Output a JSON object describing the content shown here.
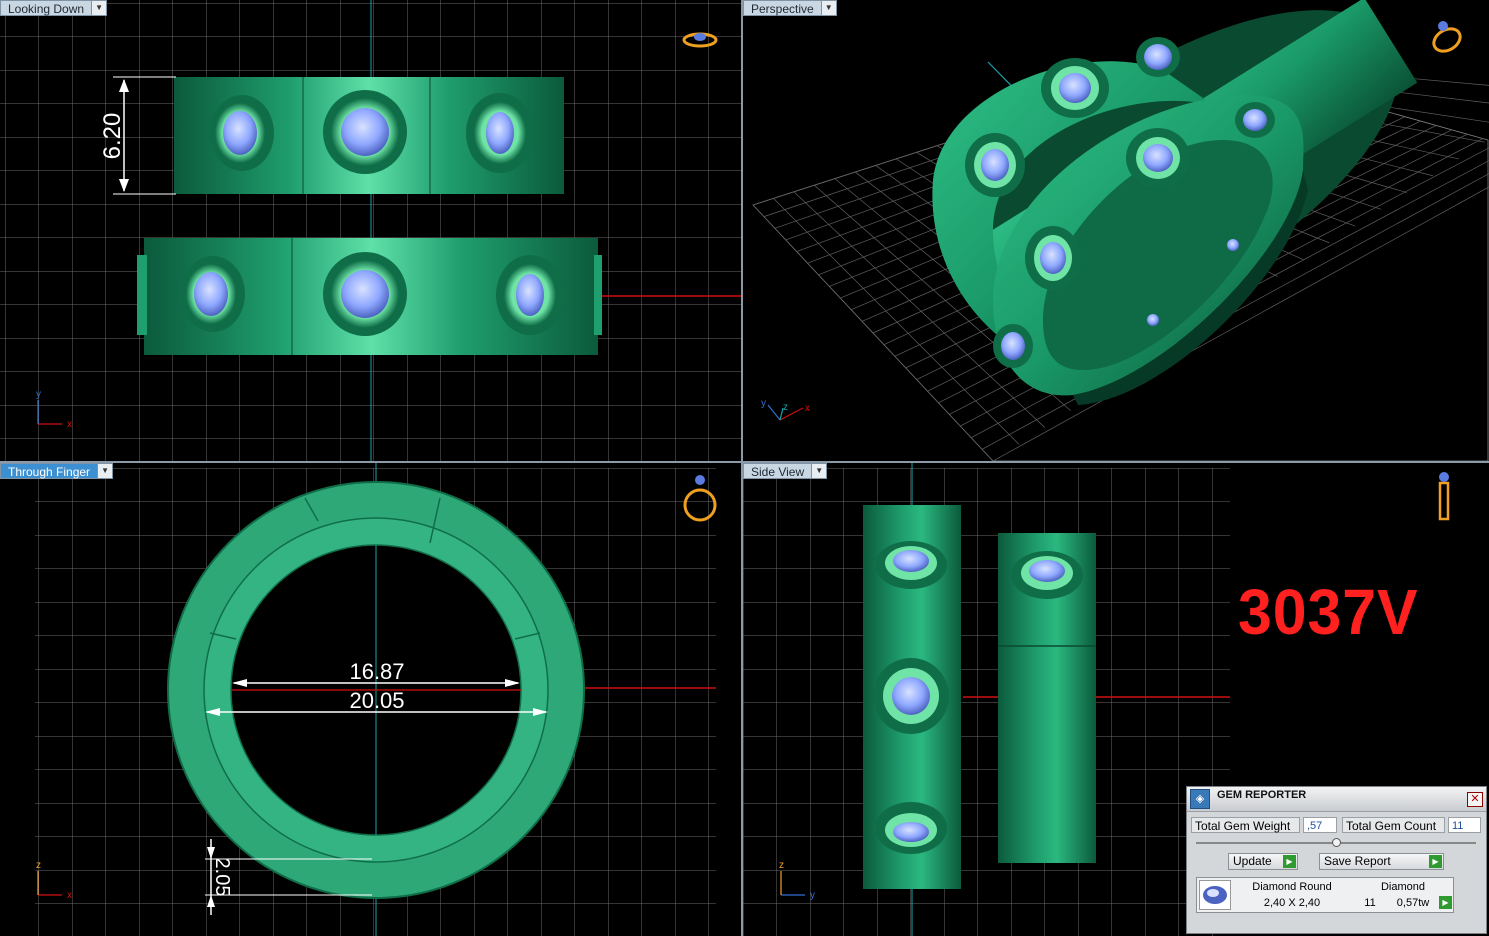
{
  "viewports": {
    "top_left": {
      "label": "Looking Down",
      "dimension": "6.20"
    },
    "top_right": {
      "label": "Perspective"
    },
    "bottom_left": {
      "label": "Through Finger",
      "dim_inner": "16.87",
      "dim_outer": "20.05",
      "dim_thickness": "2.05"
    },
    "bottom_right": {
      "label": "Side View"
    }
  },
  "axes": {
    "x": "x",
    "y": "y",
    "z": "z"
  },
  "product_code": "3037V",
  "colors": {
    "metal": "#1f9e6e",
    "gem": "#8fa8ff",
    "axis_red": "#e01010",
    "axis_teal": "#17a2a8",
    "grid": "#6d6d6d",
    "accent": "#3c8fd0"
  },
  "gem_reporter": {
    "title": "GEM REPORTER",
    "close_icon": "close-icon",
    "total_weight_label": "Total Gem Weight",
    "total_weight_value": ",57",
    "total_count_label": "Total Gem Count",
    "total_count_value": "11",
    "update_label": "Update",
    "save_report_label": "Save Report",
    "rows": [
      {
        "name": "Diamond Round",
        "size": "2,40 X 2,40",
        "type": "Diamond",
        "count": "11",
        "weight": "0,57tw"
      }
    ]
  }
}
